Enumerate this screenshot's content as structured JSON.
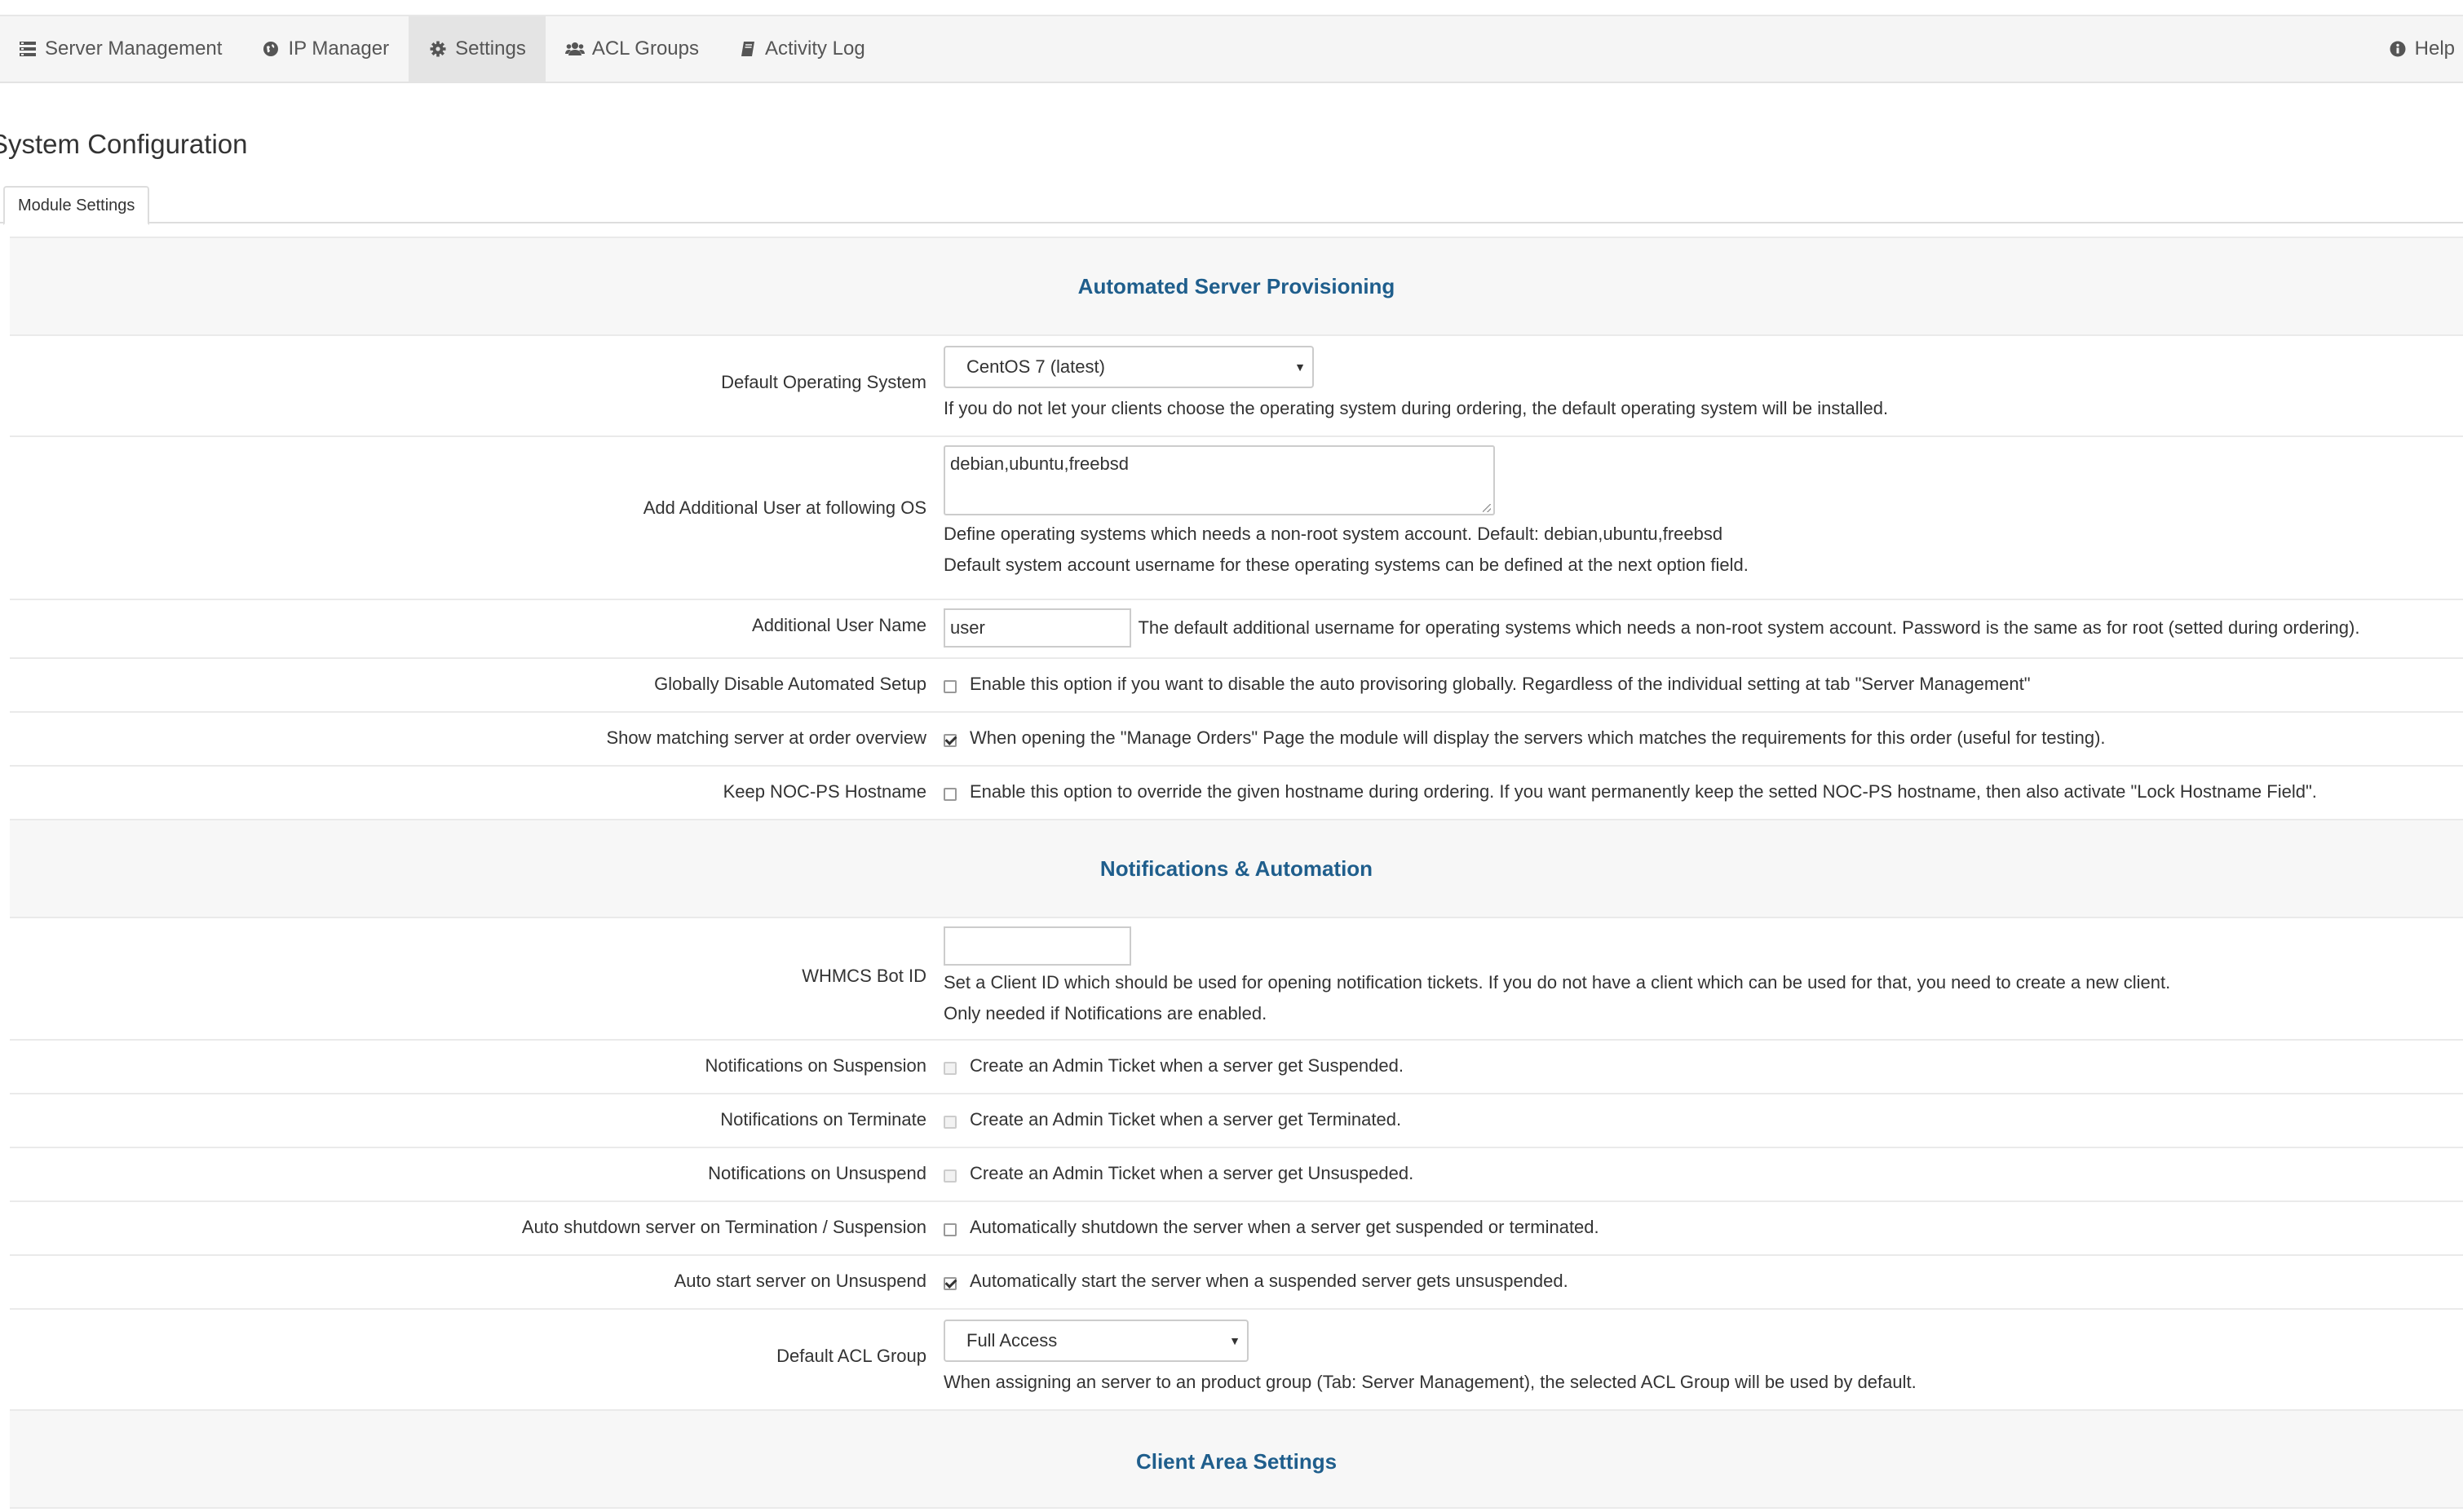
{
  "nav": {
    "items": [
      {
        "label": "Server Management",
        "icon": "server-list-icon",
        "active": false
      },
      {
        "label": "IP Manager",
        "icon": "globe-icon",
        "active": false
      },
      {
        "label": "Settings",
        "icon": "gear-icon",
        "active": true
      },
      {
        "label": "ACL Groups",
        "icon": "users-icon",
        "active": false
      },
      {
        "label": "Activity Log",
        "icon": "book-icon",
        "active": false
      }
    ],
    "help": {
      "label": "Help",
      "icon": "info-icon"
    }
  },
  "page": {
    "title": "System Configuration",
    "tab": "Module Settings"
  },
  "sections": {
    "provisioning": {
      "title": "Automated Server Provisioning",
      "default_os": {
        "label": "Default Operating System",
        "value": "CentOS 7 (latest)",
        "help": "If you do not let your clients choose the operating system during ordering, the default operating system will be installed."
      },
      "additional_user_os": {
        "label": "Add Additional User at following OS",
        "value": "debian,ubuntu,freebsd",
        "help1": "Define operating systems which needs a non-root system account. Default: debian,ubuntu,freebsd",
        "help2": "Default system account username for these operating systems can be defined at the next option field."
      },
      "additional_user_name": {
        "label": "Additional User Name",
        "value": "user",
        "help": "The default additional username for operating systems which needs a non-root system account. Password is the same as for root (setted during ordering)."
      },
      "disable_setup": {
        "label": "Globally Disable Automated Setup",
        "checked": false,
        "help": "Enable this option if you want to disable the auto provisoring globally. Regardless of the individual setting at tab \"Server Management\""
      },
      "show_matching": {
        "label": "Show matching server at order overview",
        "checked": true,
        "help": "When opening the \"Manage Orders\" Page the module will display the servers which matches the requirements for this order (useful for testing)."
      },
      "keep_hostname": {
        "label": "Keep NOC-PS Hostname",
        "checked": false,
        "help": "Enable this option to override the given hostname during ordering. If you want permanently keep the setted NOC-PS hostname, then also activate \"Lock Hostname Field\"."
      }
    },
    "notifications": {
      "title": "Notifications & Automation",
      "bot_id": {
        "label": "WHMCS Bot ID",
        "value": "",
        "help1": "Set a Client ID which should be used for opening notification tickets. If you do not have a client which can be used for that, you need to create a new client.",
        "help2": "Only needed if Notifications are enabled."
      },
      "on_suspension": {
        "label": "Notifications on Suspension",
        "checked": false,
        "help": "Create an Admin Ticket when a server get Suspended."
      },
      "on_terminate": {
        "label": "Notifications on Terminate",
        "checked": false,
        "help": "Create an Admin Ticket when a server get Terminated."
      },
      "on_unsuspend": {
        "label": "Notifications on Unsuspend",
        "checked": false,
        "help": "Create an Admin Ticket when a server get Unsuspeded."
      },
      "auto_shutdown": {
        "label": "Auto shutdown server on Termination / Suspension",
        "checked": false,
        "help": "Automatically shutdown the server when a server get suspended or terminated."
      },
      "auto_start": {
        "label": "Auto start server on Unsuspend",
        "checked": true,
        "help": "Automatically start the server when a suspended server gets unsuspended."
      },
      "default_acl": {
        "label": "Default ACL Group",
        "value": "Full Access",
        "help": "When assigning an server to an product group (Tab: Server Management), the selected ACL Group will be used by default."
      }
    },
    "client_area": {
      "title": "Client Area Settings"
    }
  },
  "colors": {
    "section_title": "#1f5e8c",
    "nav_bg": "#f5f5f5",
    "nav_active_bg": "#e4e4e4"
  }
}
